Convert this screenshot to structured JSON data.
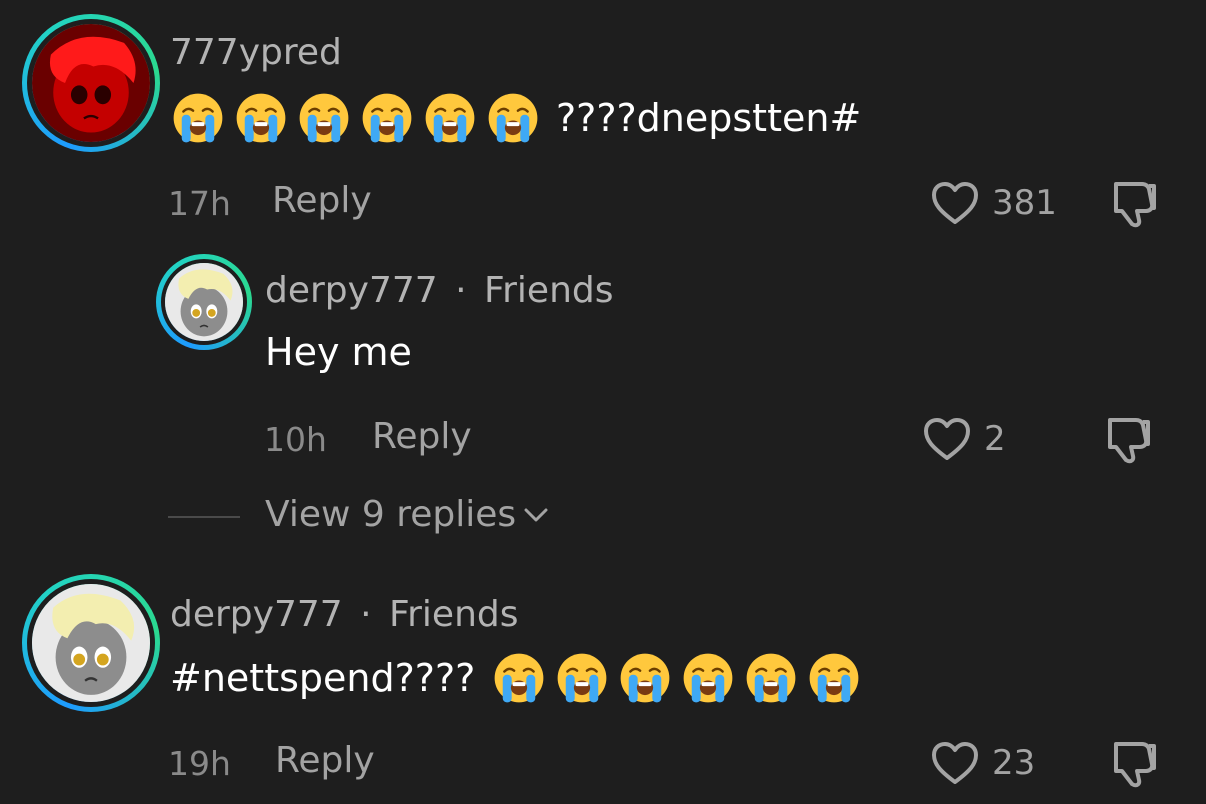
{
  "comments": [
    {
      "username": "777ypred",
      "text_suffix": "????dnepstten#",
      "emojis": [
        "loudly-crying-face",
        "loudly-crying-face",
        "loudly-crying-face",
        "loudly-crying-face",
        "loudly-crying-face",
        "loudly-crying-face"
      ],
      "time": "17h",
      "reply_label": "Reply",
      "likes": "381",
      "avatar": "red-pony-avatar"
    },
    {
      "username": "derpy777",
      "separator": "·",
      "tag": "Friends",
      "text": "Hey me",
      "time": "10h",
      "reply_label": "Reply",
      "likes": "2",
      "avatar": "grey-pony-avatar"
    },
    {
      "username": "derpy777",
      "separator": "·",
      "tag": "Friends",
      "text_prefix": "#nettspend????",
      "emojis": [
        "loudly-crying-face",
        "loudly-crying-face",
        "loudly-crying-face",
        "loudly-crying-face",
        "loudly-crying-face",
        "loudly-crying-face"
      ],
      "time": "19h",
      "reply_label": "Reply",
      "likes": "23",
      "avatar": "grey-pony-avatar"
    }
  ],
  "view_replies": {
    "label": "View 9 replies"
  },
  "colors": {
    "background": "#1e1e1e",
    "ring_start": "#1e9bff",
    "ring_end": "#2bd98f",
    "muted": "#a3a3a3"
  }
}
